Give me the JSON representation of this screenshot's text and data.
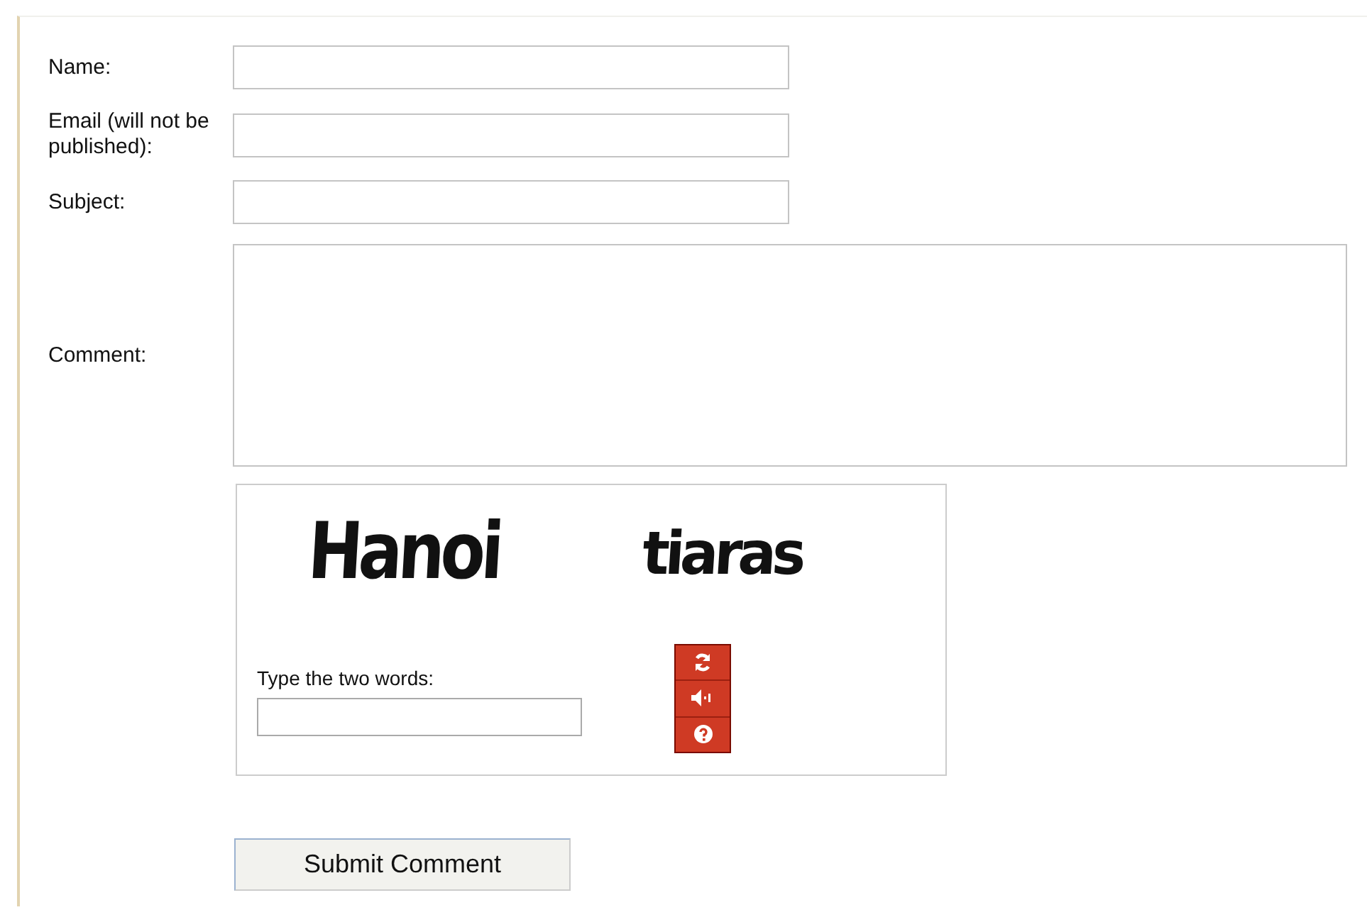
{
  "fields": [
    {
      "label": "Name:",
      "kind": "input"
    },
    {
      "label": "Email (will not be published):",
      "kind": "input"
    },
    {
      "label": "Subject:",
      "kind": "input"
    },
    {
      "label": "Comment:",
      "kind": "textarea"
    }
  ],
  "captcha": {
    "words": [
      "Hanoi",
      "tiaras"
    ],
    "prompt": "Type the two words:"
  },
  "submit": "Submit Comment"
}
